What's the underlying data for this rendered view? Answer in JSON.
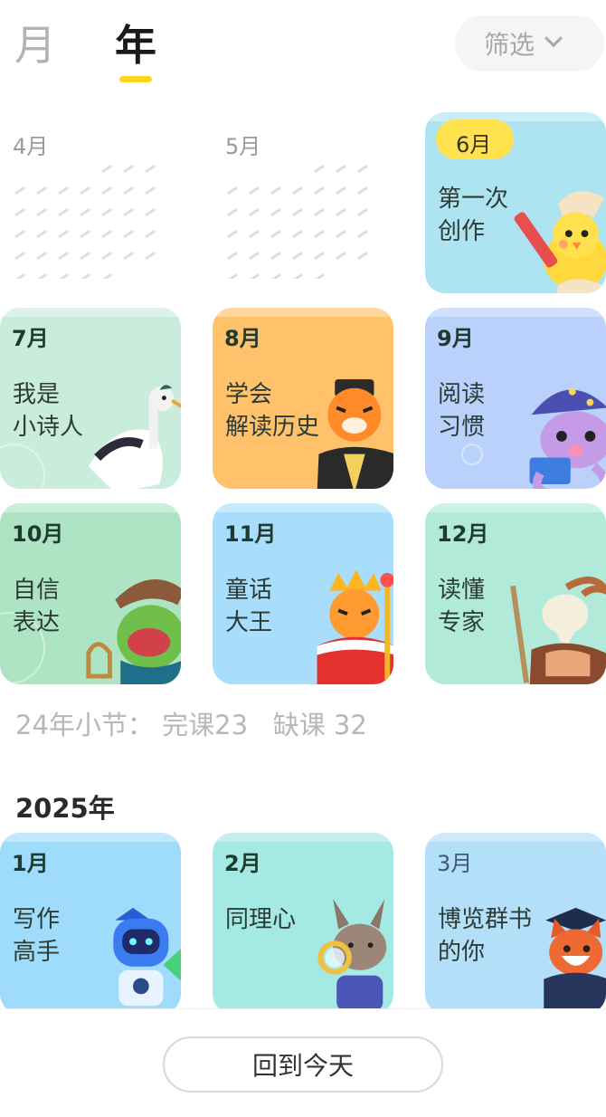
{
  "tabs": {
    "month": "月",
    "year": "年",
    "active": "年"
  },
  "filter": {
    "label": "筛选"
  },
  "row1": [
    {
      "month": "4月",
      "status": "empty"
    },
    {
      "month": "5月",
      "status": "empty"
    },
    {
      "month": "6月",
      "title": "第一次\n创作",
      "character": "chick-with-pencil",
      "bg": "#aee3f1"
    }
  ],
  "grid": [
    {
      "month": "7月",
      "title": "我是\n小诗人",
      "character": "crane",
      "bg": "#c9ecdc"
    },
    {
      "month": "8月",
      "title": "学会\n解读历史",
      "character": "tiger-official",
      "bg": "#ffc26a"
    },
    {
      "month": "9月",
      "title": "阅读\n习惯",
      "character": "octopus-wizard",
      "bg": "#b9d1fb"
    },
    {
      "month": "10月",
      "title": "自信\n表达",
      "character": "frog-bard",
      "bg": "#aee3c3"
    },
    {
      "month": "11月",
      "title": "童话\n大王",
      "character": "tiger-king",
      "bg": "#a8ddfb"
    },
    {
      "month": "12月",
      "title": "读懂\n专家",
      "character": "goat-scholar",
      "bg": "#b2ead9"
    }
  ],
  "summary": {
    "label": "24年小节：",
    "done": "完课23",
    "missed": "缺课 32"
  },
  "year2025": {
    "label": "2025年",
    "cards": [
      {
        "month": "1月",
        "title": "写作\n高手",
        "character": "robot",
        "bg": "#9fdcfb"
      },
      {
        "month": "2月",
        "title": "同理心",
        "character": "bunny-detective",
        "bg": "#a4e9e3"
      },
      {
        "month": "3月",
        "title": "博览群书\n的你",
        "character": "fox-graduate",
        "bg": "#b4dff8"
      }
    ]
  },
  "bottom": {
    "today_button": "回到今天"
  },
  "colors": {
    "accent": "#ffd51f",
    "muted": "#b7b7b7"
  }
}
